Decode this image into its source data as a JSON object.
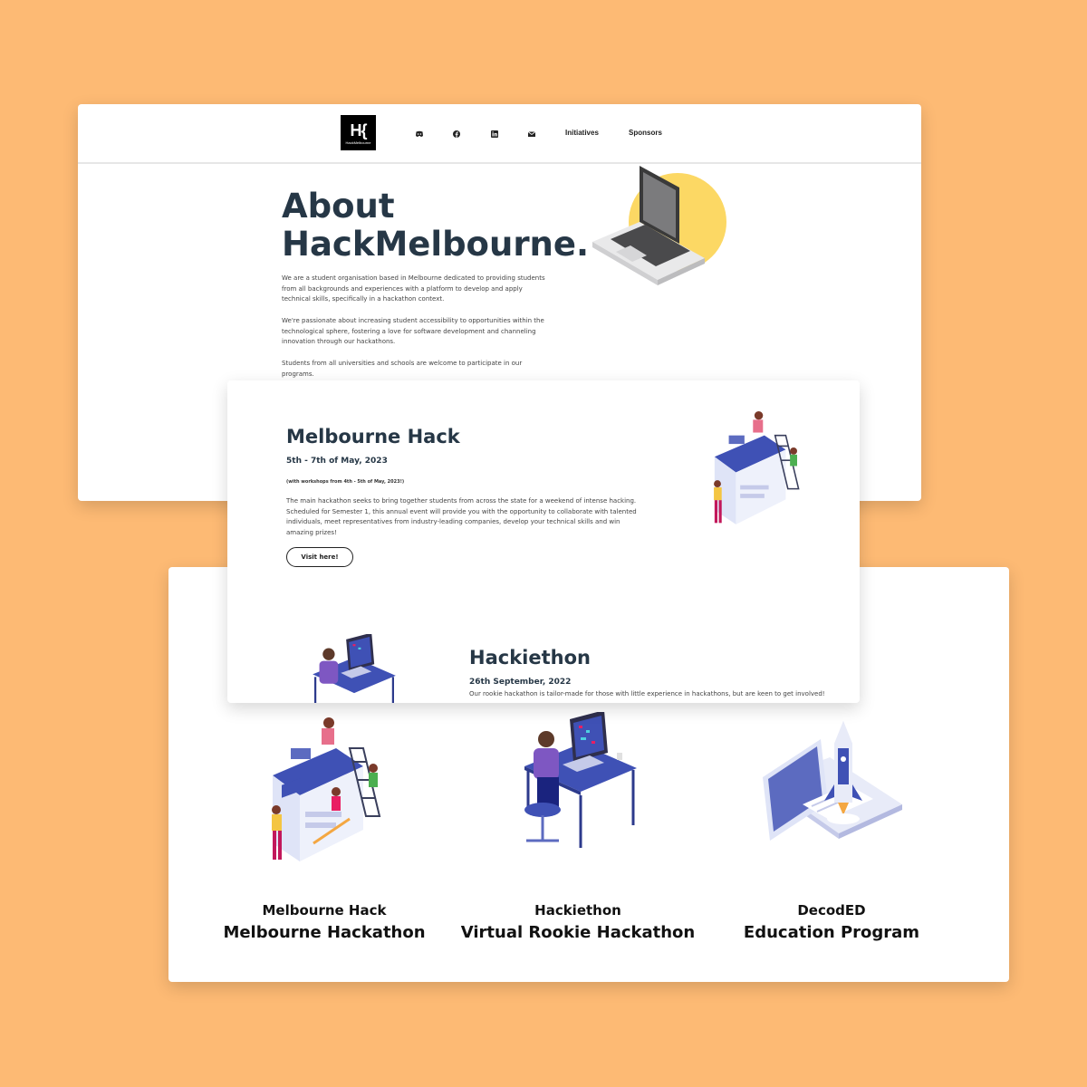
{
  "nav": {
    "logo_mark": "H{",
    "logo_text": "HackMelbourne",
    "icons": [
      "discord-icon",
      "facebook-icon",
      "linkedin-icon",
      "mail-icon"
    ],
    "links": [
      "Initiatives",
      "Sponsors"
    ]
  },
  "about": {
    "title_line1": "About",
    "title_line2": "HackMelbourne.",
    "paragraphs": [
      "We are a student organisation based in Melbourne dedicated to providing students from all backgrounds and experiences with a platform to develop and apply technical skills, specifically in a hackathon context.",
      "We're passionate about increasing student accessibility to opportunities within the technological sphere, fostering a love for software development and channeling innovation through our hackathons.",
      "Students from all universities and schools are welcome to participate in our programs."
    ]
  },
  "events": [
    {
      "title": "Melbourne Hack",
      "date": "5th - 7th of May, 2023",
      "note": "(with workshops from 4th - 5th of May, 2023!)",
      "description": "The main hackathon seeks to bring together students from across the state for a weekend of intense hacking. Scheduled for Semester 1, this annual event will provide you with the opportunity to collaborate with talented individuals, meet representatives from industry-leading companies, develop your technical skills and win amazing prizes!",
      "button": "Visit here!"
    },
    {
      "title": "Hackiethon",
      "date": "26th September, 2022",
      "description": "Our rookie hackathon is tailor-made for those with little experience in hackathons, but are keen to get involved!"
    }
  ],
  "initiatives": [
    {
      "name": "Melbourne Hack",
      "subtitle": "Melbourne Hackathon"
    },
    {
      "name": "Hackiethon",
      "subtitle": "Virtual Rookie Hackathon"
    },
    {
      "name": "DecodED",
      "subtitle": "Education Program"
    }
  ],
  "colors": {
    "background": "#FDBA74",
    "heading": "#263746",
    "illustration_blue": "#3F51B5",
    "laptop_circle": "#FCD864"
  }
}
